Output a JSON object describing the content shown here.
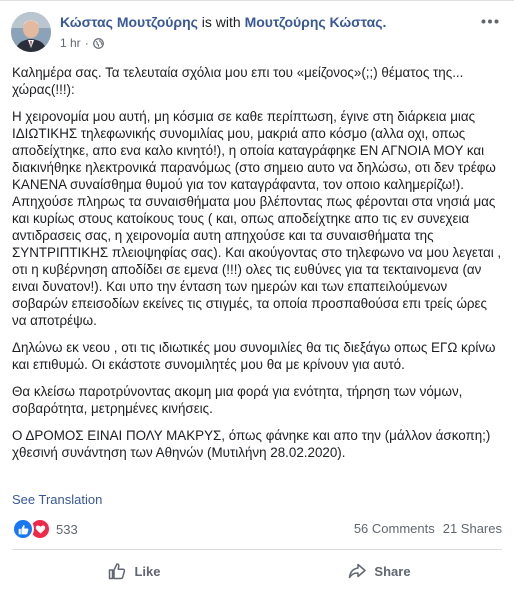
{
  "post": {
    "author": "Κώστας Μουτζούρης",
    "with_text": "is with",
    "tagged": "Μουτζούρης Κώστας.",
    "time": "1 hr",
    "time_separator": "·",
    "privacy_icon": "globe-icon",
    "paragraphs": [
      "Καλημέρα σας. Τα τελευταία σχόλια μου επι του «μείζονος»(;;) θέματος της... χώρας(!!!):",
      "Η χειρονομία μου αυτή, μη κόσμια σε καθε περίπτωση, έγινε στη διάρκεια μιας ΙΔΙΩΤΙΚΗΣ τηλεφωνικής συνομιλίας μου, μακριά απο κόσμο (αλλα οχι, οπως αποδείχτηκε, απο ενα καλο κινητό!), η οποία καταγράφηκε ΕΝ ΑΓΝΟΙΑ ΜΟΥ και διακινήθηκε ηλεκτρονικά παρανόμως (στο σημειο αυτο να δηλώσω, οτι δεν τρέφω ΚΑΝΕΝΑ συναίσθημα θυμού για τον καταγράφαντα, τον οποιο καλημερίζω!). Απηχούσε πληρως τα συναισθήματα μου βλέποντας πως φέρονται στα νησιά μας και κυρίως στους κατοίκους τους ( και, οπως αποδείχτηκε απο τις εν συνεχεια αντιδρασεις σας, η χειρονομία αυτη απηχούσε και τα συναισθήματα της ΣΥΝΤΡΙΠΤΙΚΗΣ πλειοψηφίας σας). Και ακούγοντας στο τηλεφωνο να μου λεγεται , οτι η κυβέρνηση αποδίδει σε εμενα (!!!) ολες τις ευθύνες για τα τεκταινομενα (αν ειναι δυνατον!). Και υπο την ένταση των ημερών και των επαπειλούμενων σοβαρών επεισοδίων εκείνες τις στιγμές, τα οποία προσπαθούσα επι τρείς ώρες να αποτρέψω.",
      "Δηλώνω εκ νεου , οτι τις ιδιωτικές μου συνομιλίες θα τις διεξάγω οπως ΕΓΩ κρίνω και επιθυμώ. Οι εκάστοτε συνομιλητές μου θα με κρίνουν για αυτό.",
      "Θα κλείσω παροτρύνοντας ακομη μια φορά για ενότητα, τήρηση των νόμων, σοβαρότητα, μετρημένες κινήσεις.",
      "Ο ΔΡΟΜΟΣ ΕΙΝΑΙ ΠΟΛΥ ΜΑΚΡΥΣ, όπως φάνηκε και απο την (μάλλον άσκοπη;) χθεσινή συνάντηση των Αθηνών (Μυτιλήνη 28.02.2020)."
    ],
    "see_translation": "See Translation",
    "reactions": {
      "count": "533",
      "icons": [
        "like-reaction-icon",
        "love-reaction-icon"
      ]
    },
    "comments": "56 Comments",
    "shares": "21 Shares",
    "actions": {
      "like": "Like",
      "share": "Share"
    }
  },
  "colors": {
    "link": "#385898",
    "like_blue": "#1877f2",
    "love_red": "#f0284a",
    "muted": "#606770"
  }
}
